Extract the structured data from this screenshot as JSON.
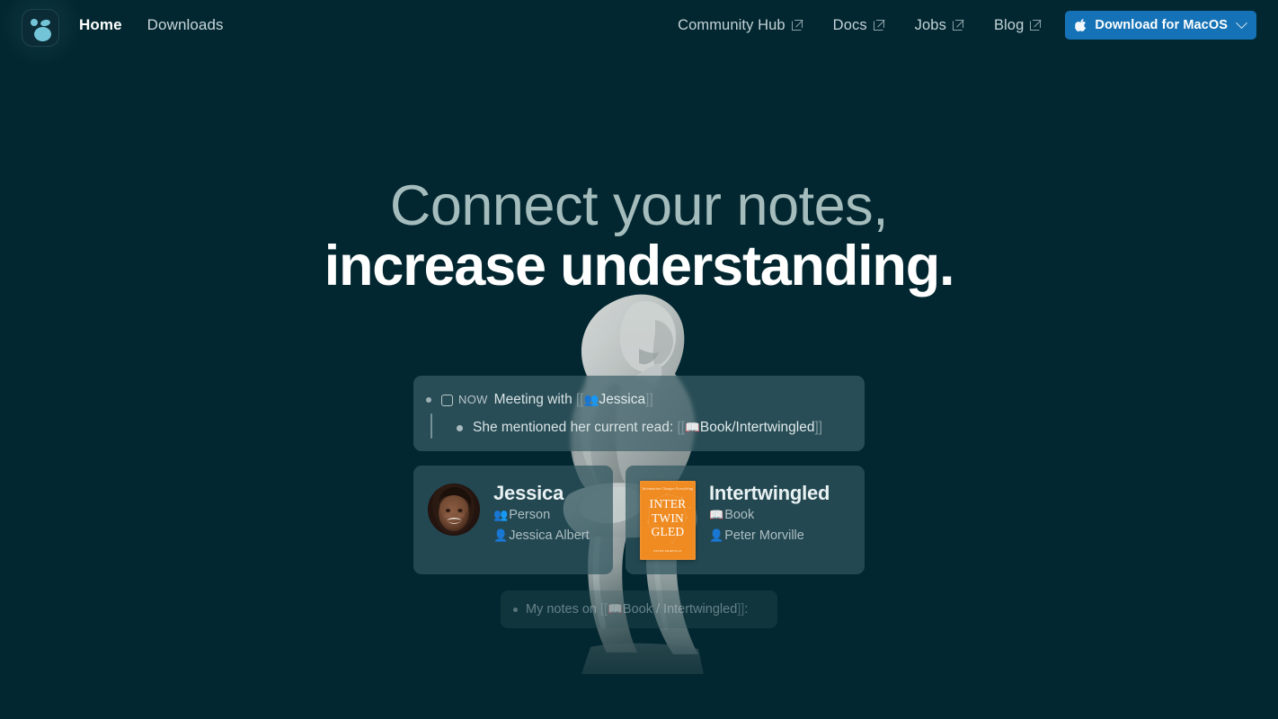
{
  "site": {
    "background_color": "#022730",
    "accent_color": "#1572b6",
    "logo_icon": "logseq-bubbles-icon"
  },
  "header": {
    "nav_left": [
      {
        "label": "Home",
        "active": true
      },
      {
        "label": "Downloads",
        "active": false
      }
    ],
    "nav_right": [
      {
        "label": "Community Hub",
        "icon": "external-link-icon"
      },
      {
        "label": "Docs",
        "icon": "external-link-icon"
      },
      {
        "label": "Jobs",
        "icon": "external-link-icon"
      },
      {
        "label": "Blog",
        "icon": "external-link-icon"
      }
    ],
    "download_button": {
      "label": "Download for MacOS",
      "platform_icon": "apple-icon",
      "dropdown_icon": "chevron-down-icon",
      "color": "#1572b6"
    }
  },
  "hero": {
    "line1": "Connect your notes,",
    "line2": "increase understanding.",
    "line1_color": "#a5bcbd",
    "line2_color": "#ffffff",
    "background_art": "the-thinker-statue"
  },
  "demo": {
    "note_card": {
      "checkbox_state": "unchecked",
      "now_tag": "NOW",
      "line1_text": "Meeting with",
      "line1_ref_open": "[[",
      "line1_ref_emoji": "👥",
      "line1_ref_label": "Jessica",
      "line1_ref_close": "]]",
      "line2_text": "She mentioned her current read:",
      "line2_ref_open": "[[",
      "line2_ref_emoji": "📖",
      "line2_ref_label": "Book/Intertwingled",
      "line2_ref_close": "]]"
    },
    "preview_cards": [
      {
        "id": "jessica",
        "title": "Jessica",
        "avatar": "portrait-photo-avatar",
        "properties": [
          {
            "emoji": "👥",
            "value": "Person"
          },
          {
            "emoji": "👤",
            "value": "Jessica Albert"
          }
        ]
      },
      {
        "id": "intertwingled",
        "title": "Intertwingled",
        "cover": {
          "top_line": "Information Changes Everything",
          "title_lines": [
            "INTER",
            "TWIN",
            "GLED"
          ],
          "bottom_line": "PETER MORVILLE",
          "color": "#ef8b21"
        },
        "properties": [
          {
            "emoji": "📖",
            "value": "Book"
          },
          {
            "emoji": "👤",
            "value": "Peter Morville"
          }
        ]
      }
    ],
    "faded_note": {
      "text_before": "My notes on",
      "ref_open": "[[",
      "ref_emoji": "📖",
      "ref_label": "Book / Intertwingled",
      "ref_close": "]]",
      "text_after": ":"
    }
  }
}
